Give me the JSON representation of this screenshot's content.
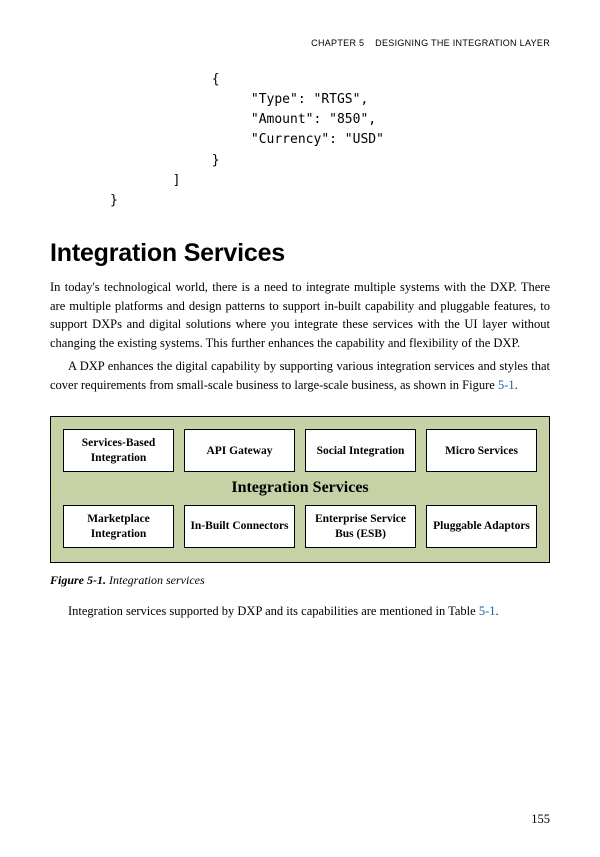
{
  "header": {
    "chapter": "CHAPTER 5",
    "title": "DESIGNING THE INTEGRATION LAYER"
  },
  "code": "             {\n                  \"Type\": \"RTGS\",\n                  \"Amount\": \"850\",\n                  \"Currency\": \"USD\"\n             }\n        ]\n}",
  "section_heading": "Integration Services",
  "para1": "In today's technological world, there is a need to integrate multiple systems with the DXP. There are multiple platforms and design patterns to support in-built capability and pluggable features, to support DXPs and digital solutions where you integrate these services with the UI layer without changing the existing systems. This further enhances the capability and flexibility of the DXP.",
  "para2a": "A DXP enhances the digital capability by supporting various integration services and styles that cover requirements from small-scale business to large-scale business, as shown in Figure ",
  "para2_ref": "5-1",
  "para2b": ".",
  "figure": {
    "row1": [
      "Services-Based Integration",
      "API Gateway",
      "Social Integration",
      "Micro Services"
    ],
    "title": "Integration Services",
    "row2": [
      "Marketplace Integration",
      "In-Built Connectors",
      "Enterprise Service Bus (ESB)",
      "Pluggable Adaptors"
    ]
  },
  "caption": {
    "label": "Figure 5-1.",
    "text": "  Integration services"
  },
  "para3a": "Integration services supported by DXP and its capabilities are mentioned in Table ",
  "para3_ref": "5-1",
  "para3b": ".",
  "page_number": "155"
}
